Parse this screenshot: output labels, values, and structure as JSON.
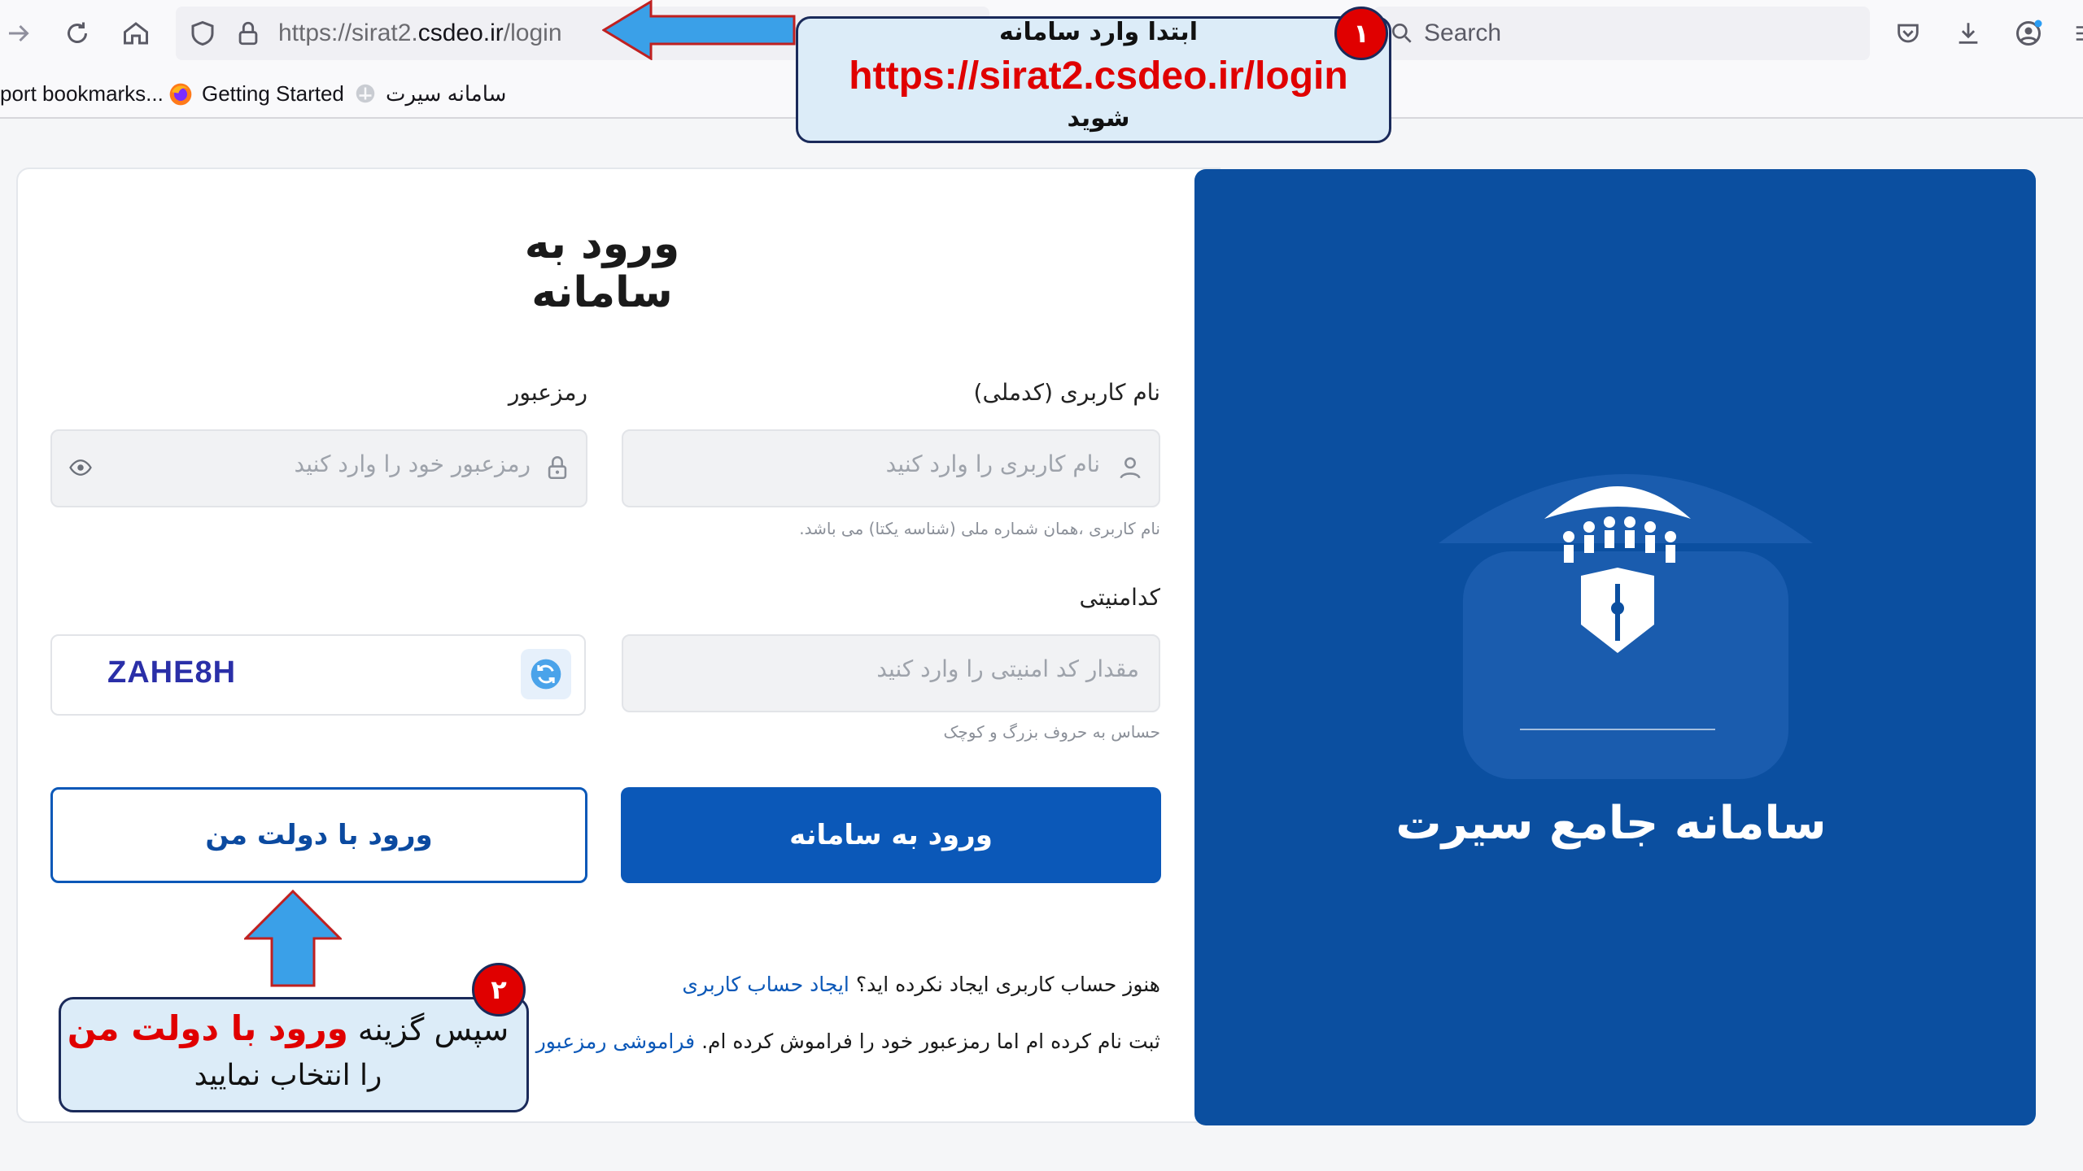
{
  "browser": {
    "url_prefix": "https://sirat2.",
    "url_domain": "csdeo.ir",
    "url_suffix": "/login",
    "search_placeholder": "Search",
    "bookmarks": [
      "port bookmarks...",
      "Getting Started",
      "سامانه سیرت"
    ]
  },
  "login": {
    "title": "ورود به سامانه",
    "username_label": "نام کاربری (کدملی)",
    "username_placeholder": "نام کاربری را وارد کنید",
    "username_hint": "نام کاربری ،همان شماره ملی (شناسه یکتا) می باشد.",
    "password_label": "رمزعبور",
    "password_placeholder": "رمزعبور خود را وارد کنید",
    "security_label": "کدامنیتی",
    "security_placeholder": "مقدار کد امنیتی را وارد کنید",
    "security_hint": "حساس به حروف بزرگ و کوچک",
    "captcha_code": "ZAHE8H",
    "submit_label": "ورود به سامانه",
    "gov_login_label": "ورود با دولت من",
    "no_account_text": "هنوز حساب کاربری ایجاد نکرده اید؟",
    "create_account_link": "ایجاد حساب کاربری",
    "forgot_text": "ثبت نام کرده ام اما رمزعبور خود را فراموش کرده ام.",
    "forgot_link": "فراموشی رمزعبور"
  },
  "panel": {
    "title": "سامانه جامع سیرت",
    "bg_color": "#0b4fa0"
  },
  "annotations": {
    "step1_badge": "۱",
    "step1_line1": "ابتدا وارد سامانه",
    "step1_url": "https://sirat2.csdeo.ir/login",
    "step1_line3": "شوید",
    "step2_badge": "۲",
    "step2_prefix": "سپس گزینه",
    "step2_highlight": "ورود با دولت من",
    "step2_line2": "را انتخاب نمایید",
    "accent_red": "#e00000",
    "arrow_blue": "#3aa0e8"
  }
}
